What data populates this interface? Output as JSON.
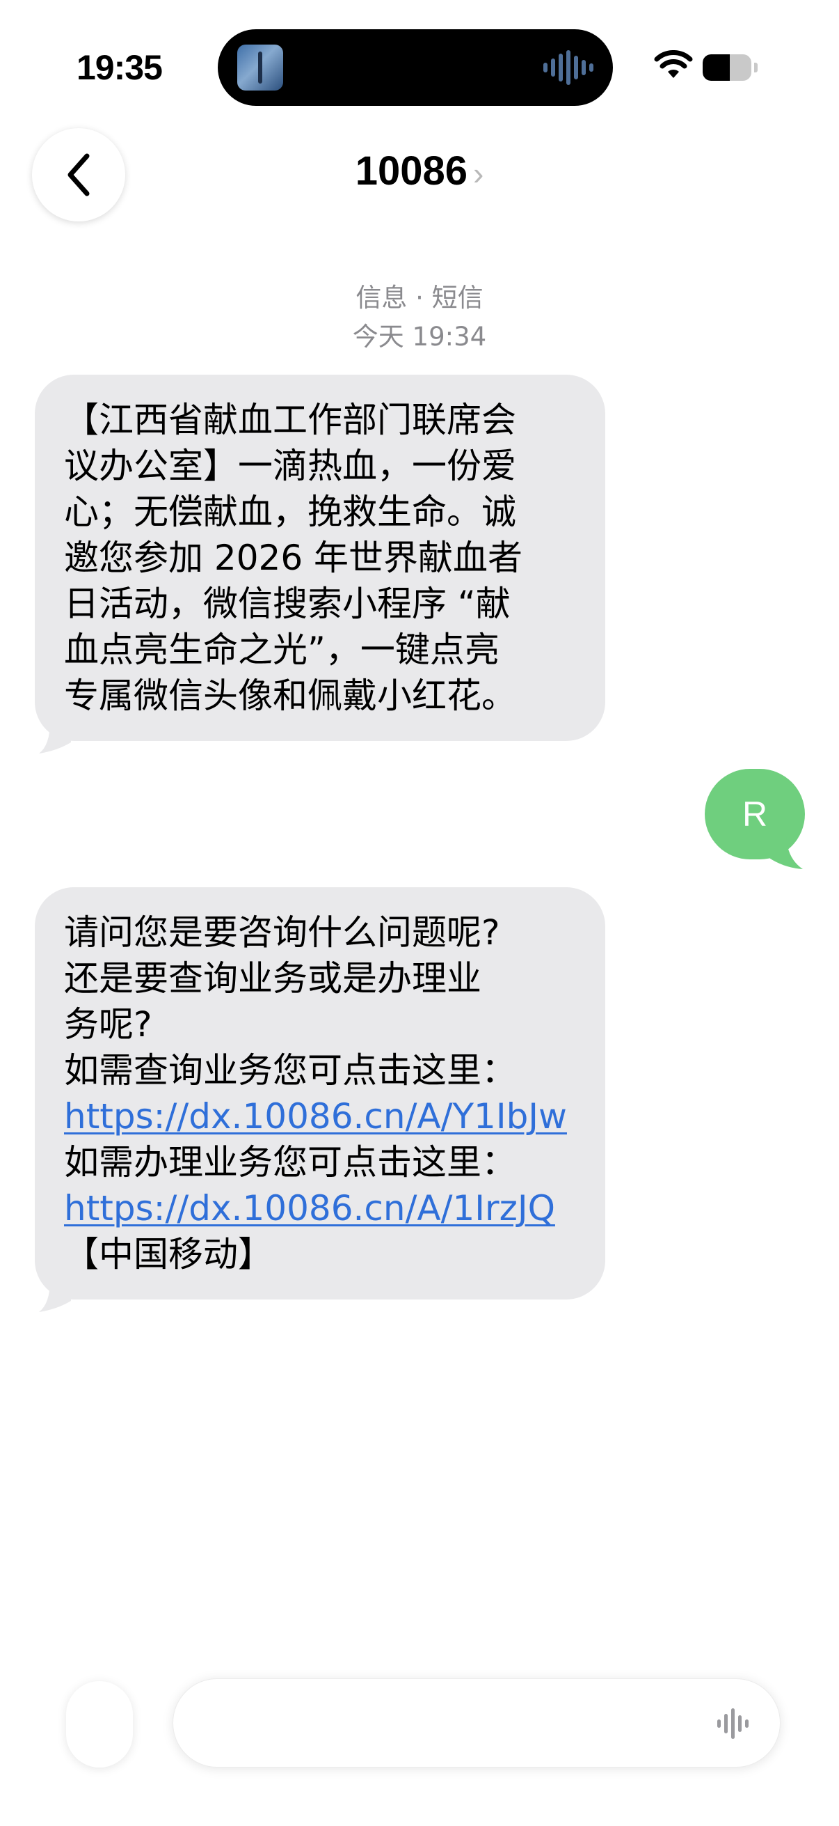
{
  "status_bar": {
    "time": "19:35",
    "battery_level": 0.55
  },
  "header": {
    "contact": "10086",
    "chevron": "›",
    "back_icon": "chevron-left-icon"
  },
  "thread_meta": {
    "service": "信息 · 短信",
    "timestamp": "今天 19:34"
  },
  "messages": [
    {
      "direction": "incoming",
      "lines": [
        "【江西省献血工作部门联席会",
        "议办公室】一滴热血，一份爱",
        "心；无偿献血，挽救生命。诚",
        "邀您参加 2026 年世界献血者",
        "日活动，微信搜索小程序 “献",
        "血点亮生命之光”，一键点亮",
        "专属微信头像和佩戴小红花。"
      ]
    },
    {
      "direction": "outgoing",
      "avatar_letter": "R"
    },
    {
      "direction": "incoming",
      "lines": [
        "请问您是要咨询什么问题呢?",
        "还是要查询业务或是办理业",
        "务呢?",
        "如需查询业务您可点击这里："
      ],
      "link1": "https://dx.10086.cn/A/Y1IbJw",
      "line_after_link1": "如需办理业务您可点击这里：",
      "link2": "https://dx.10086.cn/A/1IrzJQ",
      "signature": "【中国移动】"
    }
  ],
  "input_bar": {
    "plus_icon": "plus-icon",
    "mic_icon": "waveform-icon"
  },
  "colors": {
    "incoming_bubble": "#e9e9eb",
    "outgoing_avatar": "#6fcf7e",
    "link": "#2f6fd9",
    "meta_text": "#8a8a8e"
  }
}
